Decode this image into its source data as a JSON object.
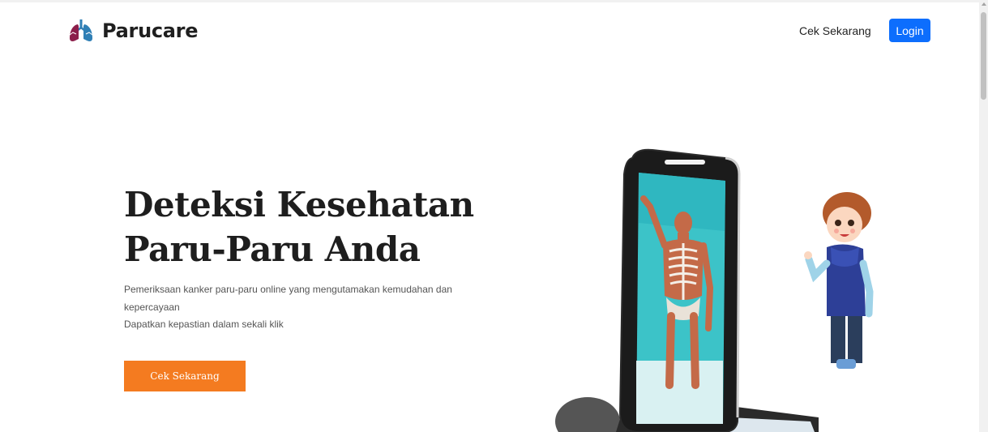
{
  "navbar": {
    "brand_name": "Parucare",
    "nav_link": "Cek Sekarang",
    "login_label": "Login"
  },
  "hero": {
    "title_line1": "Deteksi Kesehatan",
    "title_line2": "Paru-Paru Anda",
    "description_line1": "Pemeriksaan kanker paru-paru online yang mengutamakan kemudahan dan kepercayaan",
    "description_line2": "Dapatkan kepastian dalam sekali klik",
    "cta_label": "Cek Sekarang"
  },
  "colors": {
    "login_button": "#0d6efd",
    "cta_button": "#f47b20",
    "logo_left_lung": "#8b1e4a",
    "logo_right_lung": "#2f7fb5"
  },
  "icons": {
    "logo": "lungs-icon",
    "illustration": "phone-xray-boy-illustration"
  }
}
